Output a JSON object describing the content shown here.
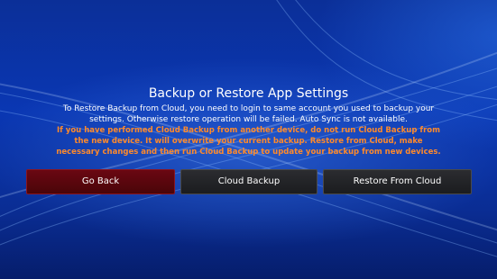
{
  "dialog": {
    "title": "Backup or Restore App Settings",
    "description": "To Restore Backup from Cloud, you need to login to same account you used to backup your settings. Otherwise restore operation will be failed.  Auto Sync is not available.",
    "warning": "If you have performed Cloud Backup from another device, do not run Cloud Backup from the new device. It will overwrite your current backup. Restore from Cloud, make necessary changes and then run Cloud Backup to update your backup from new devices."
  },
  "buttons": {
    "go_back": "Go Back",
    "cloud_backup": "Cloud Backup",
    "restore_from_cloud": "Restore From Cloud"
  },
  "colors": {
    "background": "#0a37b3",
    "warning_text": "#ff8a2b",
    "focused_button": "#6a0712",
    "button": "#2b2c30"
  }
}
